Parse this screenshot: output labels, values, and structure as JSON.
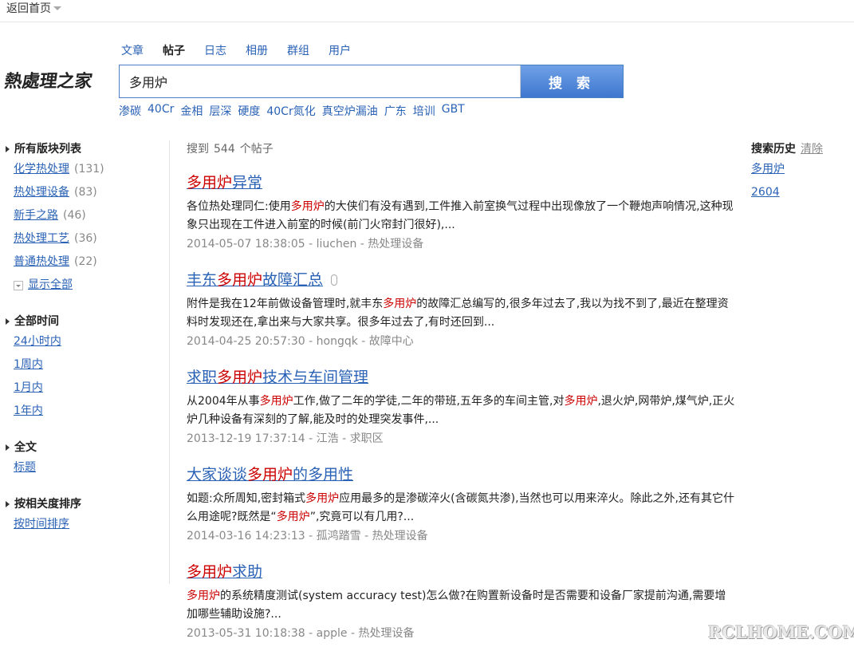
{
  "topbar": {
    "back_label": "返回首页"
  },
  "logo": {
    "text": "熱處理之家"
  },
  "search": {
    "tabs": [
      {
        "label": "文章",
        "active": false
      },
      {
        "label": "帖子",
        "active": true
      },
      {
        "label": "日志",
        "active": false
      },
      {
        "label": "相册",
        "active": false
      },
      {
        "label": "群组",
        "active": false
      },
      {
        "label": "用户",
        "active": false
      }
    ],
    "query": "多用炉",
    "button_label": "搜 索",
    "hot_keywords": [
      "渗碳",
      "40Cr",
      "金相",
      "层深",
      "硬度",
      "40Cr氮化",
      "真空炉漏油",
      "广东",
      "培训",
      "GBT"
    ]
  },
  "sidebar": {
    "forums": {
      "title": "所有版块列表",
      "items": [
        {
          "label": "化学热处理",
          "count": "(131)"
        },
        {
          "label": "热处理设备",
          "count": "(83)"
        },
        {
          "label": "新手之路",
          "count": "(46)"
        },
        {
          "label": "热处理工艺",
          "count": "(36)"
        },
        {
          "label": "普通热处理",
          "count": "(22)"
        }
      ],
      "more_label": "显示全部"
    },
    "time": {
      "title": "全部时间",
      "items": [
        "24小时内",
        "1周内",
        "1月内",
        "1年内"
      ]
    },
    "scope": {
      "title": "全文",
      "items": [
        "标题"
      ]
    },
    "sort": {
      "title": "按相关度排序",
      "items": [
        "按时间排序"
      ]
    }
  },
  "results": {
    "summary_prefix": "搜到",
    "count": "544",
    "summary_suffix": "个帖子",
    "items": [
      {
        "title_pre": "",
        "title_hl": "多用炉",
        "title_post": "异常",
        "attachment": false,
        "snippet_parts": [
          {
            "t": "各位热处理同仁:使用",
            "hl": false
          },
          {
            "t": "多用炉",
            "hl": true
          },
          {
            "t": "的大侠们有没有遇到,工件推入前室换气过程中出现像放了一个鞭炮声响情况,这种现象只出现在工件进入前室的时候(前门火帘封门很好),...",
            "hl": false
          }
        ],
        "meta": "2014-05-07 18:38:05 - liuchen - 热处理设备"
      },
      {
        "title_pre": "丰东",
        "title_hl": "多用炉",
        "title_post": "故障汇总",
        "attachment": true,
        "snippet_parts": [
          {
            "t": "附件是我在12年前做设备管理时,就丰东",
            "hl": false
          },
          {
            "t": "多用炉",
            "hl": true
          },
          {
            "t": "的故障汇总编写的,很多年过去了,我以为找不到了,最近在整理资料时发现还在,拿出来与大家共享。很多年过去了,有时还回到...",
            "hl": false
          }
        ],
        "meta": "2014-04-25 20:57:30 - hongqk - 故障中心"
      },
      {
        "title_pre": "求职",
        "title_hl": "多用炉",
        "title_post": "技术与车间管理",
        "attachment": false,
        "snippet_parts": [
          {
            "t": "从2004年从事",
            "hl": false
          },
          {
            "t": "多用炉",
            "hl": true
          },
          {
            "t": "工作,做了二年的学徒,二年的带班,五年多的车间主管,对",
            "hl": false
          },
          {
            "t": "多用炉",
            "hl": true
          },
          {
            "t": ",退火炉,网带炉,煤气炉,正火炉几种设备有深刻的了解,能及时的处理突发事件,...",
            "hl": false
          }
        ],
        "meta": "2013-12-19 17:37:14 - 江浩 - 求职区"
      },
      {
        "title_pre": "大家谈谈",
        "title_hl": "多用炉",
        "title_post": "的多用性",
        "attachment": false,
        "snippet_parts": [
          {
            "t": "如题:众所周知,密封箱式",
            "hl": false
          },
          {
            "t": "多用炉",
            "hl": true
          },
          {
            "t": "应用最多的是渗碳淬火(含碳氮共渗),当然也可以用来淬火。除此之外,还有其它什么用途呢?既然是“",
            "hl": false
          },
          {
            "t": "多用炉",
            "hl": true
          },
          {
            "t": "”,究竟可以有几用?...",
            "hl": false
          }
        ],
        "meta": "2014-03-16 14:23:13 - 孤鸿踏雪 - 热处理设备"
      },
      {
        "title_pre": "",
        "title_hl": "多用炉",
        "title_post": "求助",
        "attachment": false,
        "snippet_parts": [
          {
            "t": "多用炉",
            "hl": true
          },
          {
            "t": "的系统精度测试(system accuracy test)怎么做?在购置新设备时是否需要和设备厂家提前沟通,需要增加哪些辅助设施?...",
            "hl": false
          }
        ],
        "meta": "2013-05-31 10:18:38 - apple - 热处理设备"
      }
    ]
  },
  "history": {
    "title": "搜索历史",
    "clear_label": "清除",
    "items": [
      "多用炉",
      "2604"
    ]
  },
  "watermark": "RCLHOME.COM"
}
